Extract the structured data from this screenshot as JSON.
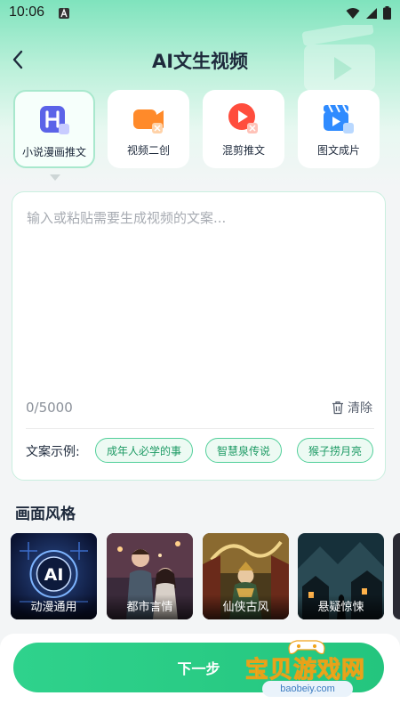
{
  "status_bar": {
    "time": "10:06",
    "icons": [
      "notification-a-icon",
      "wifi-icon",
      "signal-icon",
      "battery-icon"
    ]
  },
  "header": {
    "title": "AI文生视频",
    "back_icon": "chevron-left-icon"
  },
  "modes": [
    {
      "label": "小说漫画推文",
      "icon": "h-book-icon",
      "active": true,
      "color": "#5b63e8"
    },
    {
      "label": "视频二创",
      "icon": "video-camera-icon",
      "active": false,
      "color": "#ff8a2a"
    },
    {
      "label": "混剪推文",
      "icon": "play-circle-icon",
      "active": false,
      "color": "#ff4d3d"
    },
    {
      "label": "图文成片",
      "icon": "clapperboard-icon",
      "active": false,
      "color": "#2f8bff"
    }
  ],
  "editor": {
    "placeholder": "输入或粘贴需要生成视频的文案...",
    "value": "",
    "counter": "0/5000",
    "clear_label": "清除"
  },
  "examples": {
    "label": "文案示例:",
    "items": [
      "成年人必学的事",
      "智慧泉传说",
      "猴子捞月亮"
    ]
  },
  "styles": {
    "section_title": "画面风格",
    "items": [
      {
        "label": "动漫通用",
        "badge": "AI",
        "active": true
      },
      {
        "label": "都市言情",
        "active": false
      },
      {
        "label": "仙侠古风",
        "active": false
      },
      {
        "label": "悬疑惊悚",
        "active": false
      }
    ]
  },
  "actions": {
    "next_label": "下一步"
  },
  "watermark": {
    "title": "宝贝游戏网",
    "site": "baobeiy.com"
  },
  "colors": {
    "accent": "#2fd28c",
    "chip_border": "#51cf9a",
    "chip_text": "#1d9a64",
    "selected_style": "#4d5bdb"
  }
}
